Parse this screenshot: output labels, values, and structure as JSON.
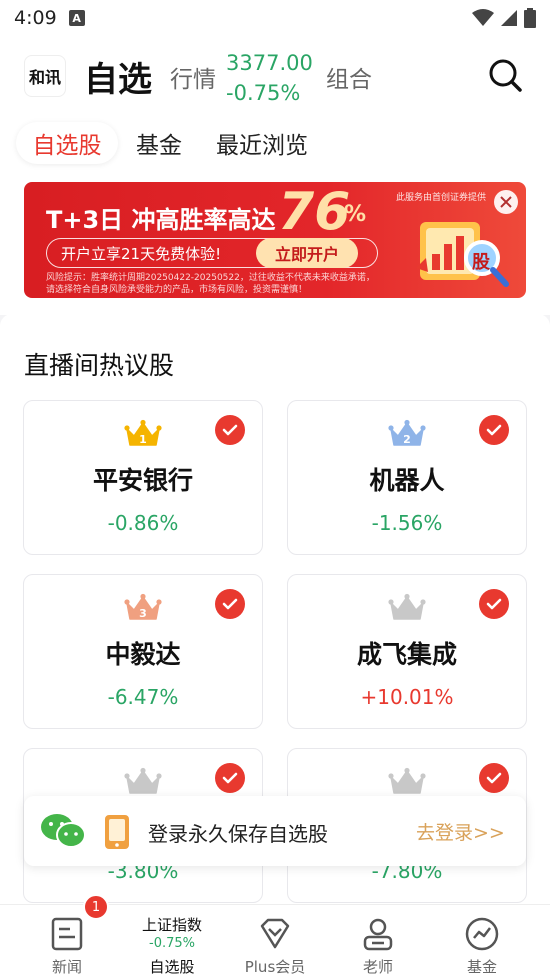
{
  "status_bar": {
    "time": "4:09",
    "icon_a": "A"
  },
  "header": {
    "logo_text": "和讯",
    "title": "自选",
    "market_label": "行情",
    "index_value": "3377.00",
    "index_change": "-0.75%",
    "combo_label": "组合"
  },
  "tabs": [
    {
      "label": "自选股"
    },
    {
      "label": "基金"
    },
    {
      "label": "最近浏览"
    }
  ],
  "banner": {
    "headline": "T+3日 冲高胜率高达",
    "big_number": "76",
    "percent": "%",
    "provider": "此服务由首创证券提供",
    "pill_text": "开户立享21天免费体验!",
    "button": "立即开户",
    "risk_line1": "风险提示：胜率统计周期20250422-20250522，过往收益不代表未来收益承诺，",
    "risk_line2": "请选择符合自身风险承受能力的产品，市场有风险，投资需谨慎！",
    "art_glyph": "股"
  },
  "section": {
    "title": "直播间热议股"
  },
  "stocks": [
    {
      "rank": "1",
      "name": "平安银行",
      "change": "-0.86%",
      "direction": "down",
      "crown_color": "#f5b400"
    },
    {
      "rank": "2",
      "name": "机器人",
      "change": "-1.56%",
      "direction": "down",
      "crown_color": "#8fb4e8"
    },
    {
      "rank": "3",
      "name": "中毅达",
      "change": "-6.47%",
      "direction": "down",
      "crown_color": "#f0a080"
    },
    {
      "rank": "",
      "name": "成飞集成",
      "change": "+10.01%",
      "direction": "up",
      "crown_color": "#c8c8c8"
    },
    {
      "rank": "",
      "name": "",
      "change": "-3.80%",
      "direction": "down",
      "crown_color": "#c8c8c8"
    },
    {
      "rank": "",
      "name": "",
      "change": "-7.80%",
      "direction": "down",
      "crown_color": "#c8c8c8"
    }
  ],
  "login_bar": {
    "text": "登录永久保存自选股",
    "link": "去登录>>"
  },
  "bottom_nav": {
    "news": {
      "label": "新闻",
      "badge": "1"
    },
    "index": {
      "name": "上证指数",
      "change": "-0.75%",
      "label": "自选股"
    },
    "plus": {
      "label": "Plus会员"
    },
    "teacher": {
      "label": "老师"
    },
    "fund": {
      "label": "基金"
    }
  },
  "colors": {
    "accent_red": "#e8392f",
    "down_green": "#2aa565",
    "login_gold": "#d9a25a"
  }
}
